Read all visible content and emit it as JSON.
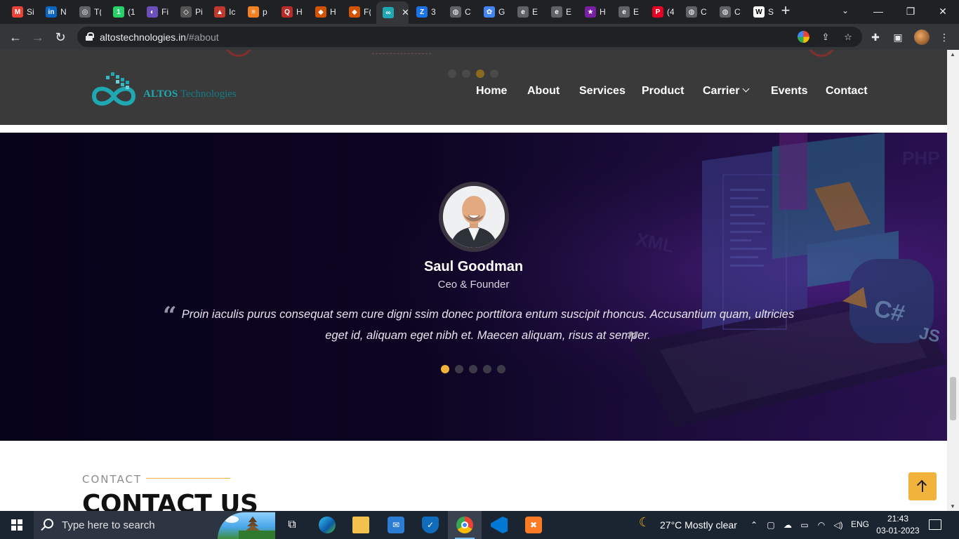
{
  "browser": {
    "tabs": [
      {
        "icon": "gmail-icon",
        "color": "#ea4335",
        "glyph": "M",
        "text": "Si"
      },
      {
        "icon": "linkedin-icon",
        "color": "#0a66c2",
        "glyph": "in",
        "text": "N"
      },
      {
        "icon": "site-icon",
        "color": "#5f6368",
        "glyph": "◎",
        "text": "T("
      },
      {
        "icon": "whatsapp-icon",
        "color": "#25d366",
        "glyph": "1",
        "text": "(1"
      },
      {
        "icon": "site-icon",
        "color": "#6b4fbb",
        "glyph": "◐",
        "text": "Fi"
      },
      {
        "icon": "site-icon",
        "color": "#555555",
        "glyph": "◇",
        "text": "Pi"
      },
      {
        "icon": "site-icon",
        "color": "#c0392b",
        "glyph": "▲",
        "text": "Ic"
      },
      {
        "icon": "stackoverflow-icon",
        "color": "#f48024",
        "glyph": "≡",
        "text": "p"
      },
      {
        "icon": "quora-icon",
        "color": "#b92b27",
        "glyph": "Q",
        "text": "H"
      },
      {
        "icon": "site-icon",
        "color": "#d35400",
        "glyph": "◆",
        "text": "H"
      },
      {
        "icon": "site-icon",
        "color": "#d35400",
        "glyph": "◆",
        "text": "F("
      },
      {
        "icon": "altos-icon",
        "color": "#1fa8b2",
        "glyph": "∞",
        "text": "",
        "active": true
      },
      {
        "icon": "site-icon",
        "color": "#1a73e8",
        "glyph": "Z",
        "text": "3"
      },
      {
        "icon": "globe-icon",
        "color": "#5f6368",
        "glyph": "◍",
        "text": "C"
      },
      {
        "icon": "site-icon",
        "color": "#4285f4",
        "glyph": "✿",
        "text": "G"
      },
      {
        "icon": "edge-icon",
        "color": "#5f6368",
        "glyph": "e",
        "text": "E"
      },
      {
        "icon": "edge-icon",
        "color": "#5f6368",
        "glyph": "e",
        "text": "E"
      },
      {
        "icon": "star-icon",
        "color": "#7b1fa2",
        "glyph": "★",
        "text": "H"
      },
      {
        "icon": "edge-icon",
        "color": "#5f6368",
        "glyph": "e",
        "text": "E"
      },
      {
        "icon": "pinterest-icon",
        "color": "#e60023",
        "glyph": "P",
        "text": "(4"
      },
      {
        "icon": "globe-icon",
        "color": "#5f6368",
        "glyph": "◍",
        "text": "C"
      },
      {
        "icon": "globe-icon",
        "color": "#5f6368",
        "glyph": "◍",
        "text": "C"
      },
      {
        "icon": "wikipedia-icon",
        "color": "#ffffff",
        "glyph": "W",
        "text": "S"
      }
    ],
    "url_host": "altostechnologies.in",
    "url_path": "/#about"
  },
  "site": {
    "logo_main": "ALTOS",
    "logo_sub": "Technologies",
    "nav": [
      "Home",
      "About",
      "Services",
      "Product",
      "Carrier",
      "Events",
      "Contact"
    ],
    "header_slider_active": 3,
    "header_slider_count": 4
  },
  "testimonial": {
    "name": "Saul Goodman",
    "role": "Ceo & Founder",
    "quote": "Proin iaculis purus consequat sem cure digni ssim donec porttitora entum suscipit rhoncus. Accusantium quam, ultricies eget id, aliquam eget nibh et. Maecen aliquam, risus at semper.",
    "active_dot": 1,
    "dot_count": 5
  },
  "contact": {
    "kicker": "CONTACT",
    "title": "CONTACT US"
  },
  "taskbar": {
    "search_placeholder": "Type here to search",
    "weather": "27°C  Mostly clear",
    "language": "ENG",
    "time": "21:43",
    "date": "03-01-2023"
  },
  "colors": {
    "accent": "#f2b33d",
    "brand": "#1fa8b2",
    "header_bg": "#3a3a3a"
  }
}
